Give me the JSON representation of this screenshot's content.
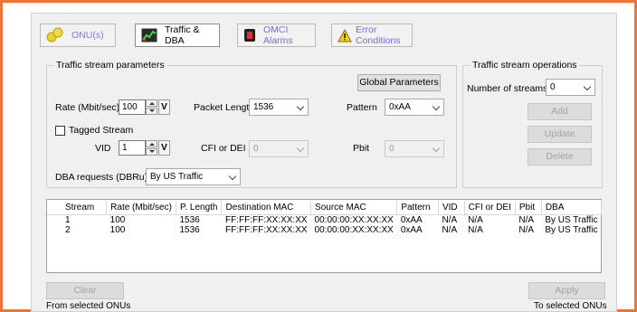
{
  "tabs": [
    {
      "label": "ONU(s)",
      "icon": "onu-circles-icon"
    },
    {
      "label": "Traffic & DBA",
      "icon": "traffic-chart-icon"
    },
    {
      "label": "OMCI Alarms",
      "icon": "alarm-device-icon"
    },
    {
      "label": "Error Conditions",
      "icon": "warning-icon"
    }
  ],
  "params": {
    "title": "Traffic stream parameters",
    "global_button": "Global Parameters",
    "rate_label": "Rate (Mbit/sec)",
    "rate_value": "100",
    "packet_length_label": "Packet Length",
    "packet_length_value": "1536",
    "pattern_label": "Pattern",
    "pattern_value": "0xAA",
    "tagged_label": "Tagged Stream",
    "vid_label": "VID",
    "vid_value": "1",
    "cfi_label": "CFI or DEI",
    "cfi_value": "0",
    "pbit_label": "Pbit",
    "pbit_value": "0",
    "dba_label": "DBA requests (DBRu):",
    "dba_value": "By US Traffic",
    "v_label": "V"
  },
  "operations": {
    "title": "Traffic stream operations",
    "streams_label": "Number of streams:",
    "streams_value": "0",
    "add": "Add",
    "update": "Update",
    "delete": "Delete"
  },
  "table": {
    "columns": [
      "Stream",
      "Rate (Mbit/sec)",
      "P. Length",
      "Destination MAC",
      "Source MAC",
      "Pattern",
      "VID",
      "CFI or DEI",
      "Pbit",
      "DBA"
    ],
    "rows": [
      [
        "1",
        "100",
        "1536",
        "FF:FF:FF:XX:XX:XX",
        "00:00:00:XX:XX:XX",
        "0xAA",
        "N/A",
        "N/A",
        "N/A",
        "By US Traffic"
      ],
      [
        "2",
        "100",
        "1536",
        "FF:FF:FF:XX:XX:XX",
        "00:00:00:XX:XX:XX",
        "0xAA",
        "N/A",
        "N/A",
        "N/A",
        "By US Traffic"
      ]
    ]
  },
  "footer": {
    "clear": "Clear",
    "clear_note": "From selected ONUs",
    "apply": "Apply",
    "apply_note": "To selected ONUs"
  },
  "colors": {
    "accent_border": "#f0733a",
    "tab_link": "#6e6ee0"
  }
}
